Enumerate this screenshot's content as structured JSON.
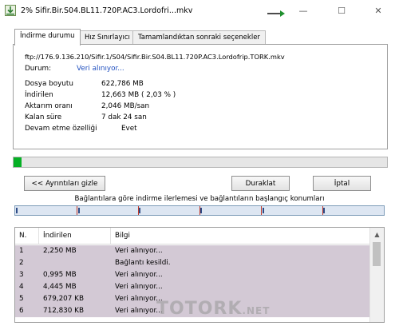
{
  "window": {
    "title": "2% Sifir.Bir.S04.BL11.720P.AC3.Lordofri...mkv",
    "minimize_glyph": "—",
    "maximize_glyph": "☐",
    "close_glyph": "✕"
  },
  "tabs": [
    {
      "label": "İndirme durumu",
      "active": true
    },
    {
      "label": "Hız Sınırlayıcı",
      "active": false
    },
    {
      "label": "Tamamlandıktan sonraki seçenekler",
      "active": false
    }
  ],
  "status": {
    "url": "ftp://176.9.136.210/Sifir.1/S04/Sifir.Bir.S04.BL11.720P.AC3.Lordofrip.TORK.mkv",
    "state_label": "Durum:",
    "state_value": "Veri alınıyor...",
    "fields": [
      {
        "label": "Dosya boyutu",
        "value": "622,786  MB"
      },
      {
        "label": "İndirilen",
        "value": "12,663  MB  ( 2,03 % )"
      },
      {
        "label": "Aktarım oranı",
        "value": "2,046  MB/san"
      },
      {
        "label": "Kalan süre",
        "value": "7 dak  24 san"
      },
      {
        "label": "Devam etme özelliği",
        "value": "Evet"
      }
    ]
  },
  "progress": {
    "percent": 2.03
  },
  "buttons": {
    "details": "<< Ayrıntıları gizle",
    "pause": "Duraklat",
    "cancel": "İptal"
  },
  "connections": {
    "caption": "Bağlantılara göre indirme ilerlemesi ve bağlantıların başlangıç konumları",
    "segment_starts": [
      0.0,
      0.167,
      0.333,
      0.5,
      0.667,
      0.833
    ],
    "segment_progress": [
      0.003,
      0.17,
      0.336,
      0.503,
      0.67,
      0.836
    ]
  },
  "table": {
    "headers": [
      "N.",
      "İndirilen",
      "Bilgi"
    ],
    "rows": [
      [
        "1",
        "2,250  MB",
        "Veri alınıyor..."
      ],
      [
        "2",
        "",
        "Bağlantı kesildi."
      ],
      [
        "3",
        "0,995  MB",
        "Veri alınıyor..."
      ],
      [
        "4",
        "4,445  MB",
        "Veri alınıyor..."
      ],
      [
        "5",
        "679,207  KB",
        "Veri alınıyor..."
      ],
      [
        "6",
        "712,830  KB",
        "Veri alınıyor..."
      ]
    ]
  },
  "watermark": {
    "main": "TOTORK",
    "suffix": ".NET"
  },
  "colors": {
    "progress": "#06b025",
    "row_selected": "#d3c9d5",
    "status_blue": "#1f4fbf"
  }
}
